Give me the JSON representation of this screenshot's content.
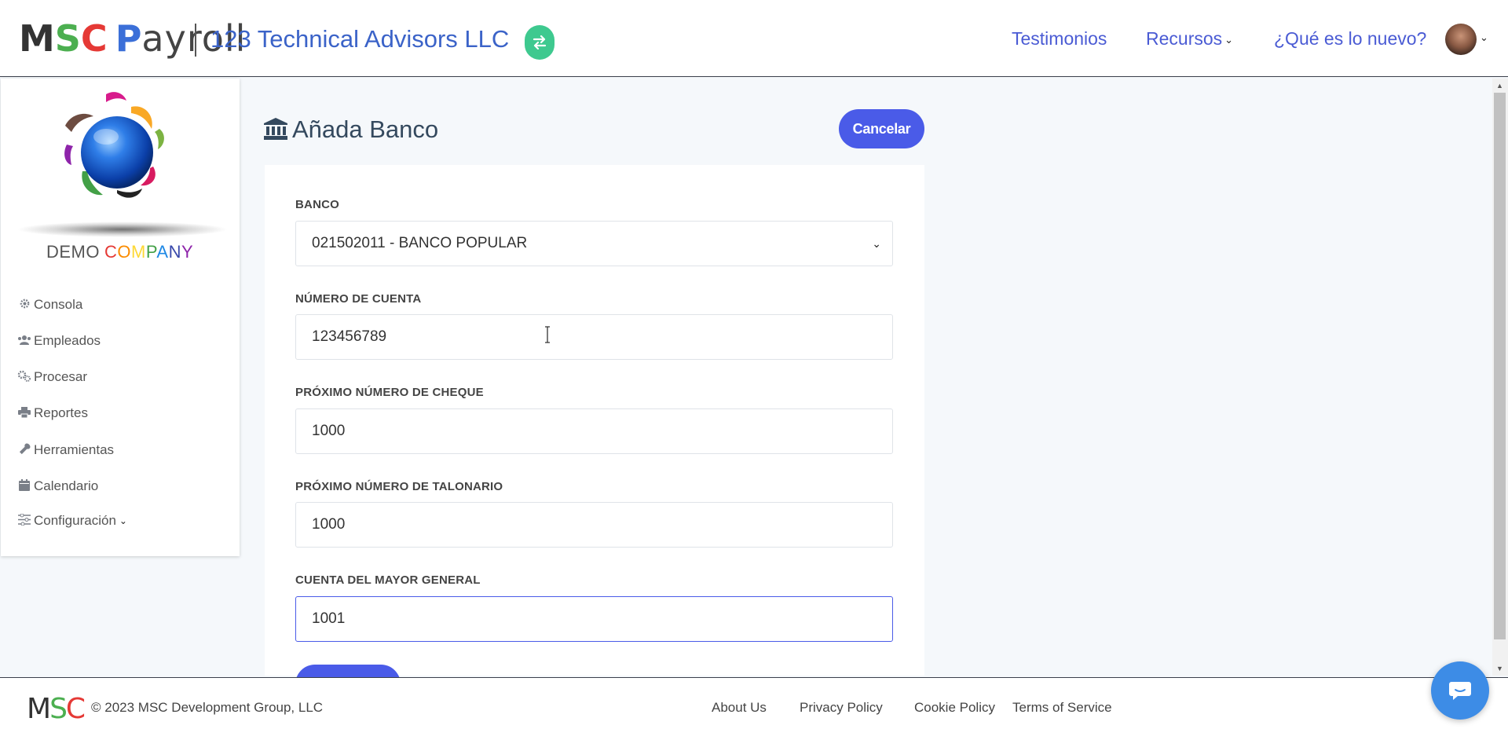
{
  "header": {
    "logo": {
      "m": "M",
      "s": "S",
      "c": "C",
      "p": "P",
      "rest": "ayroll"
    },
    "company_name": "123 Technical Advisors LLC",
    "switch_icon": "swap-arrows-icon",
    "nav": {
      "testimonios": "Testimonios",
      "recursos": "Recursos",
      "nuevo": "¿Qué es lo nuevo?"
    }
  },
  "sidebar": {
    "brand": {
      "demo": "DEMO",
      "company_letters": [
        "C",
        "O",
        "M",
        "P",
        "A",
        "N",
        "Y"
      ]
    },
    "items": [
      {
        "label": "Consola",
        "icon": "gear-icon"
      },
      {
        "label": "Empleados",
        "icon": "users-icon"
      },
      {
        "label": "Procesar",
        "icon": "cogs-icon"
      },
      {
        "label": "Reportes",
        "icon": "printer-icon"
      },
      {
        "label": "Herramientas",
        "icon": "wrench-icon"
      },
      {
        "label": "Calendario",
        "icon": "calendar-icon"
      },
      {
        "label": "Configuración",
        "icon": "sliders-icon"
      }
    ]
  },
  "main": {
    "title": "Añada Banco",
    "cancel_label": "Cancelar",
    "fields": {
      "banco": {
        "label": "BANCO",
        "value": "021502011 - BANCO POPULAR"
      },
      "cuenta": {
        "label": "NÚMERO DE CUENTA",
        "value": "123456789"
      },
      "cheque": {
        "label": "PRÓXIMO NÚMERO DE CHEQUE",
        "value": "1000"
      },
      "talonario": {
        "label": "PRÓXIMO NÚMERO DE TALONARIO",
        "value": "1000"
      },
      "mayor": {
        "label": "CUENTA DEL MAYOR GENERAL",
        "value": "1001"
      }
    }
  },
  "footer": {
    "logo": {
      "m": "M",
      "s": "S",
      "c": "C"
    },
    "copyright": "© 2023 MSC Development Group, LLC",
    "links": {
      "about": "About Us",
      "privacy": "Privacy Policy",
      "cookie": "Cookie Policy",
      "terms": "Terms of Service"
    }
  },
  "colors": {
    "accent": "#4a5be8",
    "link": "#4a5bd4",
    "switch": "#3ec98f",
    "chat": "#3d8ce6",
    "company_letter_colors": [
      "#e53935",
      "#fb8c00",
      "#fdd835",
      "#43a047",
      "#1e88e5",
      "#3949ab",
      "#8e24aa"
    ]
  }
}
